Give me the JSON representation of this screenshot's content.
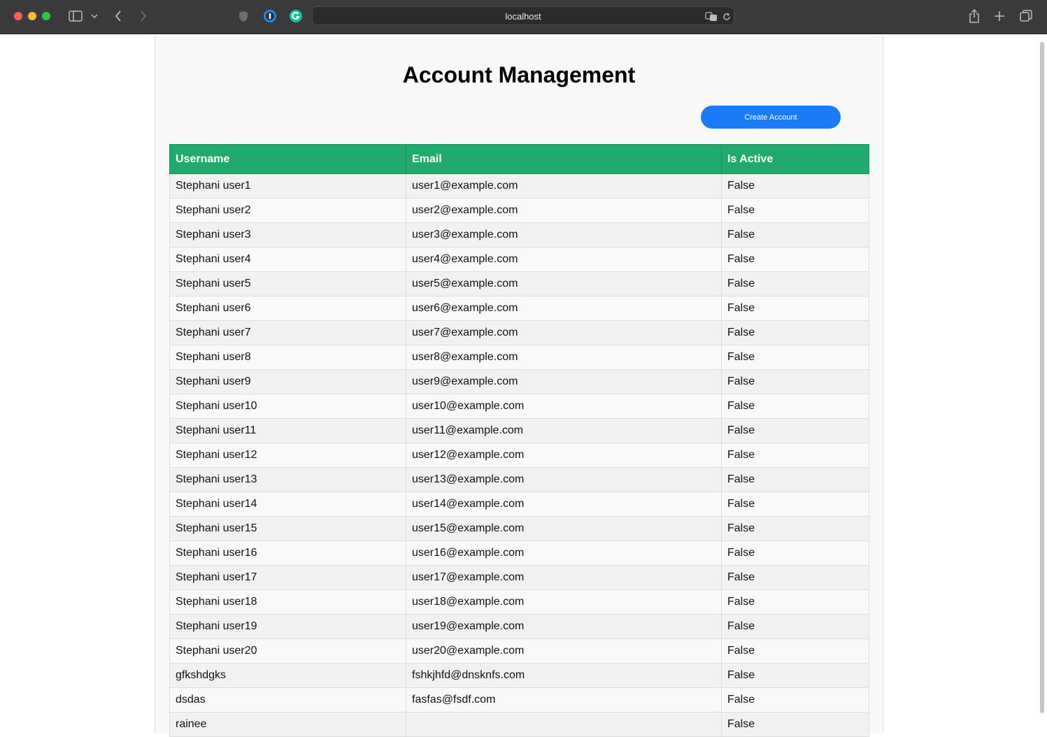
{
  "browser": {
    "url": "localhost"
  },
  "page": {
    "title": "Account Management",
    "create_button_label": "Create Account"
  },
  "table": {
    "headers": [
      "Username",
      "Email",
      "Is Active"
    ],
    "rows": [
      {
        "username": "Stephani user1",
        "email": "user1@example.com",
        "is_active": "False"
      },
      {
        "username": "Stephani user2",
        "email": "user2@example.com",
        "is_active": "False"
      },
      {
        "username": "Stephani user3",
        "email": "user3@example.com",
        "is_active": "False"
      },
      {
        "username": "Stephani user4",
        "email": "user4@example.com",
        "is_active": "False"
      },
      {
        "username": "Stephani user5",
        "email": "user5@example.com",
        "is_active": "False"
      },
      {
        "username": "Stephani user6",
        "email": "user6@example.com",
        "is_active": "False"
      },
      {
        "username": "Stephani user7",
        "email": "user7@example.com",
        "is_active": "False"
      },
      {
        "username": "Stephani user8",
        "email": "user8@example.com",
        "is_active": "False"
      },
      {
        "username": "Stephani user9",
        "email": "user9@example.com",
        "is_active": "False"
      },
      {
        "username": "Stephani user10",
        "email": "user10@example.com",
        "is_active": "False"
      },
      {
        "username": "Stephani user11",
        "email": "user11@example.com",
        "is_active": "False"
      },
      {
        "username": "Stephani user12",
        "email": "user12@example.com",
        "is_active": "False"
      },
      {
        "username": "Stephani user13",
        "email": "user13@example.com",
        "is_active": "False"
      },
      {
        "username": "Stephani user14",
        "email": "user14@example.com",
        "is_active": "False"
      },
      {
        "username": "Stephani user15",
        "email": "user15@example.com",
        "is_active": "False"
      },
      {
        "username": "Stephani user16",
        "email": "user16@example.com",
        "is_active": "False"
      },
      {
        "username": "Stephani user17",
        "email": "user17@example.com",
        "is_active": "False"
      },
      {
        "username": "Stephani user18",
        "email": "user18@example.com",
        "is_active": "False"
      },
      {
        "username": "Stephani user19",
        "email": "user19@example.com",
        "is_active": "False"
      },
      {
        "username": "Stephani user20",
        "email": "user20@example.com",
        "is_active": "False"
      },
      {
        "username": "gfkshdgks",
        "email": "fshkjhfd@dnsknfs.com",
        "is_active": "False"
      },
      {
        "username": "dsdas",
        "email": "fasfas@fsdf.com",
        "is_active": "False"
      },
      {
        "username": "rainee",
        "email": "",
        "is_active": "False"
      }
    ]
  }
}
